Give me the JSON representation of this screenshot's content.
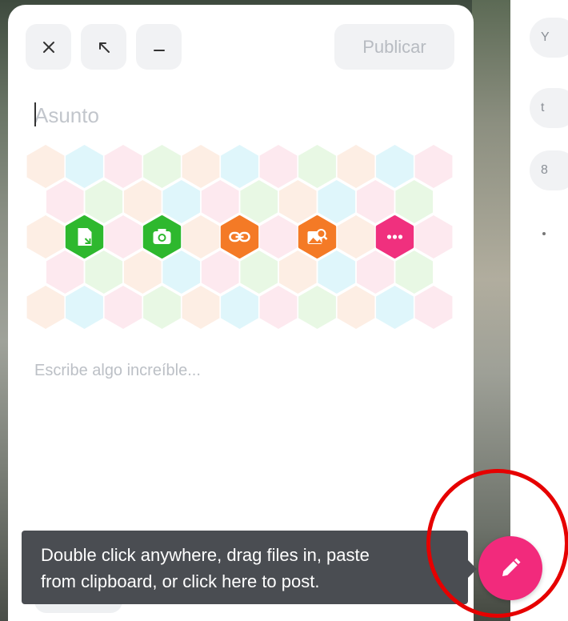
{
  "toolbar": {
    "close_icon": "close-icon",
    "expand_icon": "expand-arrow-icon",
    "minimize_icon": "minimize-icon",
    "publish_label": "Publicar"
  },
  "editor": {
    "subject_placeholder": "Asunto",
    "body_placeholder": "Escribe algo increíble..."
  },
  "attachments": [
    {
      "name": "document-upload-icon",
      "color": "#2eb82e"
    },
    {
      "name": "camera-icon",
      "color": "#2eb82e"
    },
    {
      "name": "link-icon",
      "color": "#f47a26"
    },
    {
      "name": "image-search-icon",
      "color": "#f47a26"
    },
    {
      "name": "more-icon",
      "color": "#f0307e"
    }
  ],
  "hex_palette": [
    "#fdeee4",
    "#dff6fb",
    "#fde9ef",
    "#e8f8e4"
  ],
  "tooltip": {
    "line1": "Double click anywhere, drag files in, paste",
    "line2": "from clipboard, or click here to post."
  },
  "fab": {
    "icon": "pencil-icon",
    "color": "#f22a7c"
  },
  "right_panel": {
    "items": [
      "Y",
      "t",
      "8"
    ]
  }
}
